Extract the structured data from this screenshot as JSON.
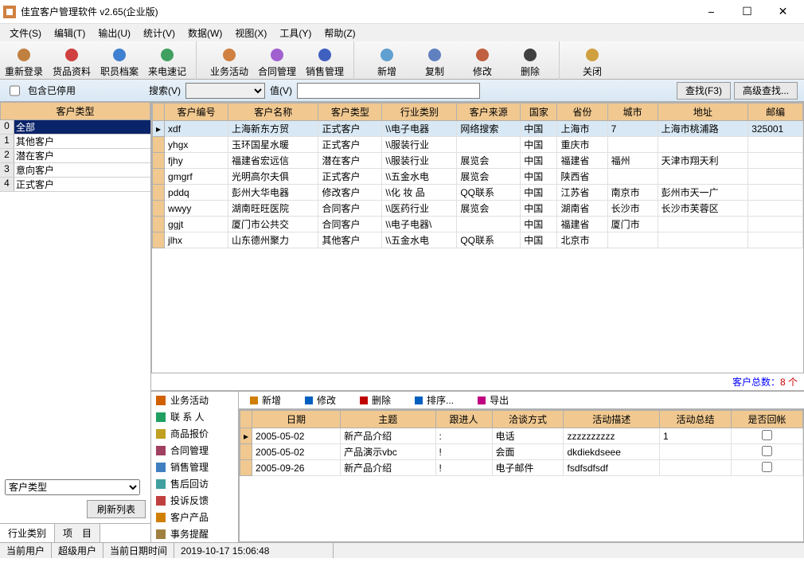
{
  "title": "佳宜客户管理软件 v2.65(企业版)",
  "menus": [
    "文件(S)",
    "编辑(T)",
    "输出(U)",
    "统计(V)",
    "数据(W)",
    "视图(X)",
    "工具(Y)",
    "帮助(Z)"
  ],
  "toolbar": [
    "重新登录",
    "货品资料",
    "职员档案",
    "来电速记",
    "|",
    "业务活动",
    "合同管理",
    "销售管理",
    "|",
    "新增",
    "复制",
    "修改",
    "删除",
    "|",
    "关闭"
  ],
  "searchbar": {
    "chkLabel": "包含已停用",
    "searchLabel": "搜索(V)",
    "valueLabel": "值(V)",
    "findBtn": "查找(F3)",
    "advBtn": "高级查找..."
  },
  "left": {
    "header": "客户类型",
    "rows": [
      {
        "idx": "0",
        "txt": "全部",
        "sel": true
      },
      {
        "idx": "1",
        "txt": "其他客户"
      },
      {
        "idx": "2",
        "txt": "潜在客户"
      },
      {
        "idx": "3",
        "txt": "意向客户"
      },
      {
        "idx": "4",
        "txt": "正式客户"
      }
    ],
    "combo": "客户类型",
    "refreshBtn": "刷新列表",
    "tabs": [
      "行业类别",
      "项　目"
    ]
  },
  "mainGrid": {
    "headers": [
      "",
      "客户编号",
      "客户名称",
      "客户类型",
      "行业类别",
      "客户来源",
      "国家",
      "省份",
      "城市",
      "地址",
      "邮编"
    ],
    "rows": [
      {
        "ptr": true,
        "sel": true,
        "cells": [
          "xdf",
          "上海新东方贸",
          "正式客户",
          "\\\\电子电器",
          "网络搜索",
          "中国",
          "上海市",
          "7",
          "上海市桃浦路",
          "325001"
        ]
      },
      {
        "cells": [
          "yhgx",
          "玉环国星水暖",
          "正式客户",
          "\\\\服装行业",
          "",
          "中国",
          "重庆市",
          "",
          "",
          ""
        ]
      },
      {
        "cells": [
          "fjhy",
          "福建省宏远信",
          "潜在客户",
          "\\\\服装行业",
          "展览会",
          "中国",
          "福建省",
          "福州",
          "天津市翔天利",
          ""
        ]
      },
      {
        "cells": [
          "gmgrf",
          "光明高尔夫俱",
          "正式客户",
          "\\\\五金水电",
          "展览会",
          "中国",
          "陕西省",
          "",
          "",
          ""
        ]
      },
      {
        "cells": [
          "pddq",
          "彭州大华电器",
          "修改客户",
          "\\\\化 妆 品",
          "QQ联系",
          "中国",
          "江苏省",
          "南京市",
          "彭州市天一广",
          ""
        ]
      },
      {
        "cells": [
          "wwyy",
          "湖南旺旺医院",
          "合同客户",
          "\\\\医药行业",
          "展览会",
          "中国",
          "湖南省",
          "长沙市",
          "长沙市芙蓉区",
          ""
        ]
      },
      {
        "cells": [
          "ggjt",
          "厦门市公共交",
          "合同客户",
          "\\\\电子电器\\",
          "",
          "中国",
          "福建省",
          "厦门市",
          "",
          ""
        ]
      },
      {
        "cells": [
          "jlhx",
          "山东德州聚力",
          "其他客户",
          "\\\\五金水电",
          "QQ联系",
          "中国",
          "北京市",
          "",
          "",
          ""
        ]
      }
    ]
  },
  "totalLabel": "客户总数：",
  "totalValue": "8 个",
  "detailNav": [
    "业务活动",
    "联 系 人",
    "商品报价",
    "合同管理",
    "销售管理",
    "售后回访",
    "投诉反馈",
    "客户产品",
    "事务提醒"
  ],
  "detailToolbar": [
    {
      "label": "新增",
      "color": "#d08000"
    },
    {
      "label": "修改",
      "color": "#0060c0"
    },
    {
      "label": "删除",
      "color": "#c00000"
    },
    {
      "label": "排序...",
      "color": "#0060c0"
    },
    {
      "label": "导出",
      "color": "#c00080"
    }
  ],
  "detailGrid": {
    "headers": [
      "",
      "日期",
      "主题",
      "跟进人",
      "洽谈方式",
      "活动描述",
      "活动总结",
      "是否回帐"
    ],
    "rows": [
      {
        "ptr": true,
        "cells": [
          "2005-05-02",
          "新产品介绍",
          ":",
          "电话",
          "zzzzzzzzzz",
          "1",
          ""
        ]
      },
      {
        "cells": [
          "2005-05-02",
          "产品演示vbc",
          "!",
          "会面",
          "dkdiekdseee",
          "",
          ""
        ]
      },
      {
        "cells": [
          "2005-09-26",
          "新产品介绍",
          "!",
          "电子邮件",
          "fsdfsdfsdf",
          "",
          ""
        ]
      }
    ]
  },
  "statusbar": {
    "userLbl": "当前用户",
    "user": "超级用户",
    "dateLbl": "当前日期时间",
    "date": "2019-10-17 15:06:48"
  }
}
